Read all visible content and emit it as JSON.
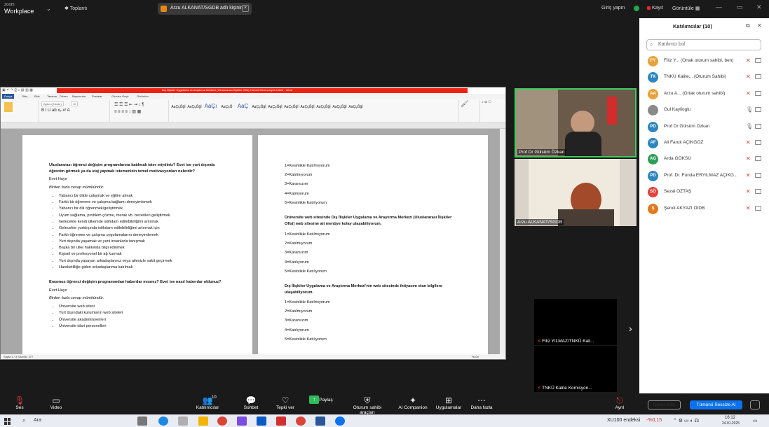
{
  "app": {
    "brand_top": "zoom",
    "brand_bottom": "Workplace",
    "meeting_label": "Toplantı"
  },
  "share_pill": {
    "text": "Arzu ALKANAT/SGDB adlı kişinin"
  },
  "top_right": {
    "signin": "Giriş yapın",
    "record": "Kayıt",
    "view": "Görüntüle"
  },
  "word": {
    "title": "Dış İlişkiler Uygulama ve Araştırma Merkezi (Uluslararası İlişkiler Ofisi) Hizmet Memnuniyet Anketi - Word",
    "tabs": [
      "Dosya",
      "Giriş",
      "Ekle",
      "Tasarım",
      "Düzen",
      "Başvurular",
      "Postalar",
      "Gözden Geçir",
      "Görünüm"
    ],
    "font_name": "Aptos (Gövde)",
    "font_size": "10",
    "styles": [
      "AaÇçĞğİ",
      "AaÇçĞğİ",
      "AaÇı",
      "AaÇçĞ",
      "AaÇ",
      "AaÇçĞğİ",
      "AaÇçĞğİ",
      "AaÇçĞğİ",
      "AaÇçĞğİ",
      "AaÇçĞğİ",
      "AaÇçĞğİ",
      "AaÇçĞğİ"
    ],
    "style_names": [
      "¶ Normal",
      "¶ Aralık Yok",
      "Başlık 1",
      "Başlık 2",
      "Konu Başlığı",
      "Alt Konu B...",
      "Hafif Vurgu",
      "Vurgu",
      "Güçlü Vurgu",
      "Güçlü",
      "Tırnak",
      "Keskin Tır...",
      "Hafif Başv.",
      "Güçlü Başv.",
      "Kitap Başlığı"
    ],
    "status_left": "Sayfa 1 / 3    Sözcük: 377",
    "status_right": "%100",
    "page1": {
      "q1": "Uluslararası öğrenci değişim programlarına katılmak ister miydiniz? Evet ise yurt dışında öğrenim görmek ya da staj yapmak istemenizin temel motivasyonları nelerdir?",
      "q1_opts": "Evet   Hayır",
      "q1_note": "Birden fazla cevap mümkündür.",
      "q1_items": [
        "Yabancı bir dilde çalışmak ve eğitim almak",
        "Farklı bir öğrenme ve çalışma bağlamı deneyimlemek",
        "Yabancı bir dili öğrenmek/geliştirmek",
        "Uyum sağlama, problem çözme, merak vb. becerileri geliştirmek",
        "Gelecekte kendi ülkemde istihdam edilebilirliğimi artırmak",
        "Gelecekte yurtdışında istihdam edilebilirliğimi artırmak için",
        "Farklı öğrenme ve çalışma uygulamalarını deneyimlemek",
        "Yurt dışında yaşamak ve yeni insanlarla tanışmak",
        "Başka bir ülke hakkında bilgi edinmek",
        "Kişisel ve profesyonel bir ağ kurmak",
        "Yurt dışında yaşayan arkadaşlarınız veya ailenizle vakit geçirmek",
        "Hareketliliğe giden arkadaşlarıma katılmak"
      ],
      "q2": "Erasmus öğrenci değişim programından haberdar mısınız? Evet ise nasıl haberdar oldunuz?",
      "q2_opts": "Evet   Hayır",
      "q2_note": "Birden fazla cevap mümkündür.",
      "q2_items": [
        "Üniversite web sitesi",
        "Yurt dışındaki kurumların web siteleri",
        "Üniversite akademisyenleri",
        "Üniversite idari personelleri"
      ]
    },
    "page2": {
      "scale_a": [
        "1=Kesinlikle Katılmıyorum",
        "2=Katılmıyorum",
        "3=Kararsızım",
        "4=Katılıyorum",
        "5=Kesinlikle Katılıyorum"
      ],
      "q3": "Üniversite web sitesinde Dış İlişkiler Uygulama ve Araştırma Merkezi (Uluslararası İlişkiler Ofisi) web sitesine ait menüye kolay ulaşabiliyorum.",
      "scale_b": [
        "1=Kesinlikle Katılmıyorum",
        "2=Katılmıyorum",
        "3=Kararsızım",
        "4=Katılıyorum",
        "5=Kesinlikle Katılıyorum"
      ],
      "q4": "Dış İlişkiler Uygulama ve Araştırma Merkezi'nin web sitesinde ihtiyacım olan bilgilere ulaşabiliyorum.",
      "scale_c": [
        "1=Kesinlikle Katılmıyorum",
        "2=Katılmıyorum",
        "3=Kararsızım",
        "4=Katılıyorum",
        "5=Kesinlikle Katılıyorum"
      ]
    }
  },
  "videos": {
    "v1": "Prof Dr Gülsüm Özkan",
    "v2": "Arzu ALKANAT/SGDB",
    "v3": "Filiz YILMAZ/TNKÜ Kali...",
    "v4": "TNKÜ Kalite Komisyon..."
  },
  "participants": {
    "title": "Katılımcılar (10)",
    "search_placeholder": "Katılımcı bul",
    "items": [
      {
        "initials": "FY",
        "name": "Filiz Y... (Ortak oturum sahibi, ben)",
        "color": "#e8a23a"
      },
      {
        "initials": "TK",
        "name": "TNKÜ Kalite... (Oturum Sahibi)",
        "color": "#2e86c1"
      },
      {
        "initials": "AA",
        "name": "Arzu A... (Ortak oturum sahibi)",
        "color": "#e8a23a"
      },
      {
        "initials": "",
        "name": "Gul Kaylioglu",
        "color": "#8a8a8a"
      },
      {
        "initials": "PD",
        "name": "Prof Dr Gülsüm Özkan",
        "color": "#2e86c1"
      },
      {
        "initials": "AF",
        "name": "Ali Faruk AÇIKGÖZ",
        "color": "#2e86c1"
      },
      {
        "initials": "AG",
        "name": "Arda GÖKSU",
        "color": "#2f9e58"
      },
      {
        "initials": "PD",
        "name": "Prof. Dr. Funda ERYILMAZ AÇIKG...",
        "color": "#2e86c1"
      },
      {
        "initials": "SÖ",
        "name": "Sezai ÖZTAŞ",
        "color": "#e0443a"
      },
      {
        "initials": "Ş",
        "name": "Şenol AKYAZI ÖİDB",
        "color": "#e07a1f"
      }
    ],
    "invite": "Davet Edin",
    "mute_all": "Tümünü Sessize Al",
    "more": "···"
  },
  "toolbar": {
    "items": [
      {
        "label": "Ses",
        "icon": "mic-off-icon"
      },
      {
        "label": "Video",
        "icon": "video-icon"
      },
      {
        "label": "Katılımcılar",
        "icon": "participants-icon",
        "count": "10"
      },
      {
        "label": "Sohbet",
        "icon": "chat-icon"
      },
      {
        "label": "Tepki ver",
        "icon": "heart-icon"
      },
      {
        "label": "Paylaş",
        "icon": "share-icon"
      },
      {
        "label": "Oturum sahibi araçları",
        "icon": "shield-icon"
      },
      {
        "label": "AI Companion",
        "icon": "ai-companion-icon"
      },
      {
        "label": "Uygulamalar",
        "icon": "apps-icon"
      },
      {
        "label": "Daha fazla",
        "icon": "more-icon"
      },
      {
        "label": "Ayrıl",
        "icon": "leave-icon"
      }
    ]
  },
  "taskbar": {
    "search": "Ara",
    "ticker": "XU100 endeksi",
    "ticker_value": "-%0,15",
    "time": "16:12",
    "date": "24.01.2025"
  }
}
